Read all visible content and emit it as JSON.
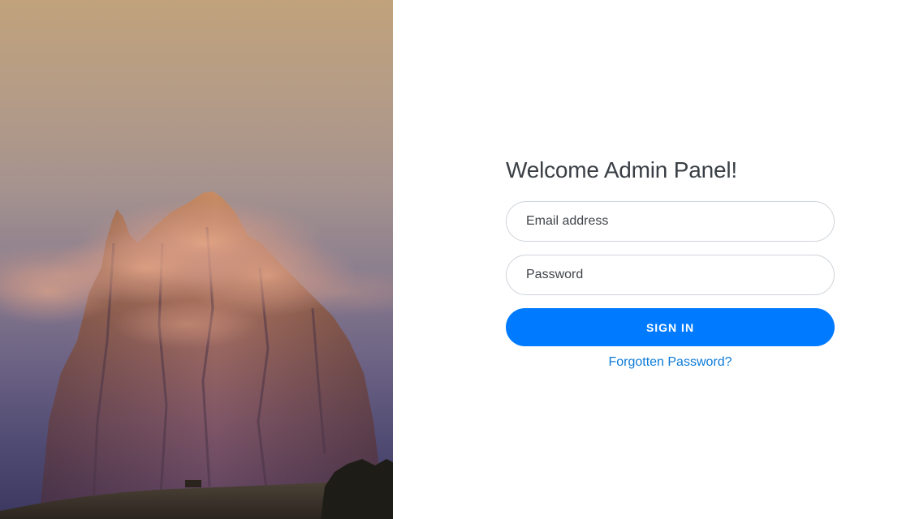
{
  "hero": {
    "image_subject": "mountain-peak-in-clouds-at-sunset"
  },
  "login": {
    "title": "Welcome Admin Panel!",
    "email_placeholder": "Email address",
    "email_value": "",
    "password_placeholder": "Password",
    "password_value": "",
    "submit_label": "SIGN IN",
    "forgot_label": "Forgotten Password?"
  },
  "colors": {
    "accent": "#007bff",
    "link": "#0b7ad8",
    "title": "#3a3f45",
    "field_border": "#cfd4da"
  }
}
